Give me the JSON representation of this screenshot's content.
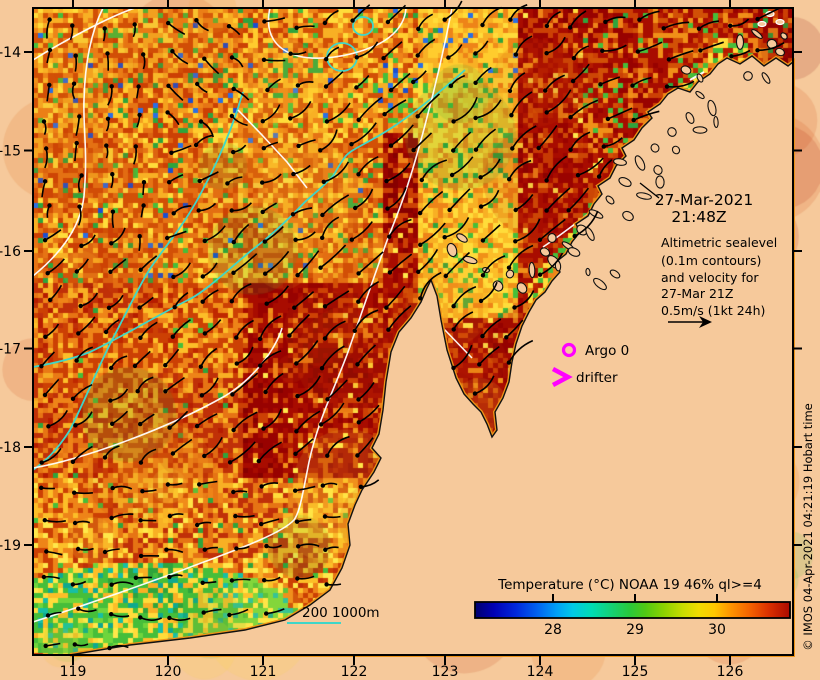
{
  "map": {
    "timestamp_line1": "27-Mar-2021",
    "timestamp_line2": "21:48Z",
    "annotation_lines": [
      "Altimetric sealevel",
      "(0.1m contours)",
      "and velocity for",
      "27-Mar 21Z",
      "0.5m/s (1kt 24h)"
    ],
    "markers": {
      "argo_label": "Argo 0",
      "drifter_label": "drifter",
      "marker_color": "#FF00FF"
    },
    "depth_legend_label": "200 1000m",
    "colorbar": {
      "title": "Temperature (°C) NOAA 19 46% ql>=4",
      "tick_labels": [
        "28",
        "29",
        "30"
      ]
    },
    "axes": {
      "lon_tick_labels": [
        "119",
        "120",
        "121",
        "122",
        "123",
        "124",
        "125",
        "126"
      ],
      "lat_tick_labels": [
        "-14",
        "-15",
        "-16",
        "-17",
        "-18",
        "-19"
      ]
    },
    "credit": "© IMOS 04-Apr-2021 04:21:19 Hobart time",
    "colors": {
      "land": "#F6C99B",
      "bathymetry_contour": "#3FD6C8",
      "sealevel_contour": "#FFFFFF",
      "velocity_arrow": "#000000"
    }
  }
}
